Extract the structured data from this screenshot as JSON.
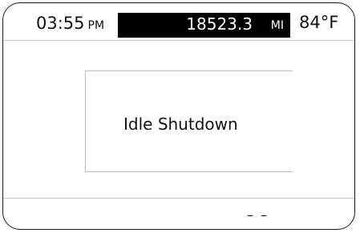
{
  "status_bar": {
    "time": "03:55",
    "ampm": "PM",
    "odometer_value": "18523.3",
    "odometer_unit": "MI",
    "temperature": "84°F"
  },
  "message": {
    "text": "Idle Shutdown"
  },
  "footer": {
    "text": "– –"
  }
}
